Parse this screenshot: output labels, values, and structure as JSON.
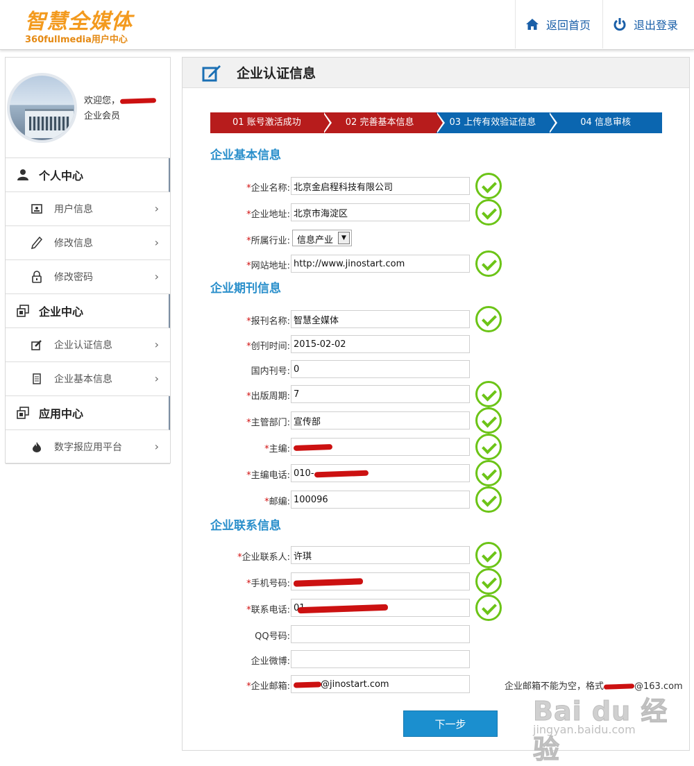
{
  "header": {
    "logo_text": "智慧全媒体",
    "logo_sub": "360fullmedia用户中心",
    "home_label": "返回首页",
    "logout_label": "退出登录"
  },
  "user": {
    "welcome_prefix": "欢迎您，",
    "role": "企业会员"
  },
  "sidebar": {
    "sections": [
      {
        "label": "个人中心",
        "icon": "user-icon"
      },
      {
        "label": "企业中心",
        "icon": "windows-icon"
      },
      {
        "label": "应用中心",
        "icon": "windows-icon"
      }
    ],
    "items": [
      {
        "label": "用户信息",
        "icon": "id-card-icon"
      },
      {
        "label": "修改信息",
        "icon": "pencil-icon"
      },
      {
        "label": "修改密码",
        "icon": "lock-icon"
      },
      {
        "label": "企业认证信息",
        "icon": "edit-icon"
      },
      {
        "label": "企业基本信息",
        "icon": "document-icon"
      },
      {
        "label": "数字报应用平台",
        "icon": "fire-icon"
      }
    ],
    "chevron": "›"
  },
  "main": {
    "title": "企业认证信息",
    "steps": [
      {
        "label": "01 账号激活成功",
        "state": "done"
      },
      {
        "label": "02 完善基本信息",
        "state": "done"
      },
      {
        "label": "03 上传有效验证信息",
        "state": "todo"
      },
      {
        "label": "04 信息审核",
        "state": "todo"
      }
    ],
    "groups": {
      "basic": "企业基本信息",
      "journal": "企业期刊信息",
      "contact": "企业联系信息"
    },
    "fields": {
      "company_name": {
        "label": "企业名称:",
        "value": "北京金启程科技有限公司"
      },
      "company_address": {
        "label": "企业地址:",
        "value": "北京市海淀区"
      },
      "industry": {
        "label": "所属行业:",
        "value": "信息产业"
      },
      "website": {
        "label": "网站地址:",
        "value": "http://www.jinostart.com"
      },
      "paper_name": {
        "label": "报刊名称:",
        "value": "智慧全媒体"
      },
      "founded": {
        "label": "创刊时间:",
        "value": "2015-02-02"
      },
      "domestic_no": {
        "label": "国内刊号:",
        "value": "0"
      },
      "period": {
        "label": "出版周期:",
        "value": "7"
      },
      "department": {
        "label": "主管部门:",
        "value": "宣传部"
      },
      "editor": {
        "label": "主编:",
        "value": ""
      },
      "editor_phone": {
        "label": "主编电话:",
        "value": "010-"
      },
      "postcode": {
        "label": "邮编:",
        "value": "100096"
      },
      "contact_person": {
        "label": "企业联系人:",
        "value": "许琪"
      },
      "mobile": {
        "label": "手机号码:",
        "value": ""
      },
      "phone": {
        "label": "联系电话:",
        "value": "01"
      },
      "qq": {
        "label": "QQ号码:",
        "value": ""
      },
      "weibo": {
        "label": "企业微博:",
        "value": ""
      },
      "email": {
        "label": "企业邮箱:",
        "value": "@jinostart.com"
      }
    },
    "email_hint": "企业邮箱不能为空，格式",
    "email_hint_tail": "@163.com",
    "required_mark": "*",
    "next_label": "下一步"
  },
  "watermark": {
    "main": "Bai du 经验",
    "sub": "jingyan.baidu.com"
  },
  "colors": {
    "step_done": "#b71c1c",
    "step_todo": "#0b66b0",
    "group_title": "#2a8fcb",
    "check_green": "#6cc417",
    "required_red": "#d21111",
    "button_blue": "#1b8fcf"
  }
}
